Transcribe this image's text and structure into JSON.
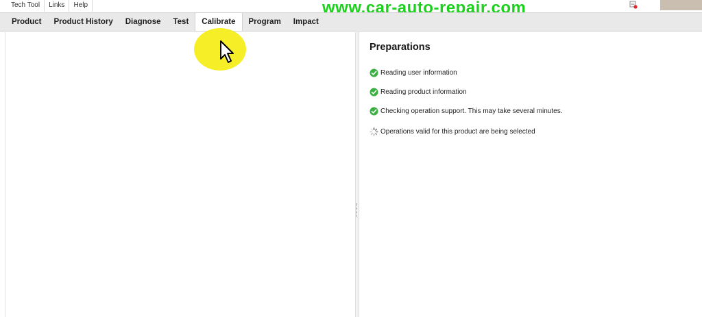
{
  "menubar": {
    "items": [
      "Tech Tool",
      "Links",
      "Help"
    ]
  },
  "watermark": "www.car-auto-repair.com",
  "tabs": [
    {
      "label": "Product"
    },
    {
      "label": "Product History"
    },
    {
      "label": "Diagnose"
    },
    {
      "label": "Test"
    },
    {
      "label": "Calibrate",
      "active": true
    },
    {
      "label": "Program"
    },
    {
      "label": "Impact"
    }
  ],
  "preparations": {
    "title": "Preparations",
    "steps": [
      {
        "label": "Reading user information",
        "status": "done",
        "icon": "check-circle-icon"
      },
      {
        "label": "Reading product information",
        "status": "done",
        "icon": "check-circle-icon"
      },
      {
        "label": "Checking operation support. This may take several minutes.",
        "status": "done",
        "icon": "check-circle-icon"
      },
      {
        "label": "Operations valid for this product are being selected",
        "status": "in-progress",
        "icon": "spinner-icon"
      }
    ]
  },
  "colors": {
    "success": "#3cb043",
    "watermark": "#1cd11c",
    "cursor_highlight": "#f5ee1b"
  }
}
